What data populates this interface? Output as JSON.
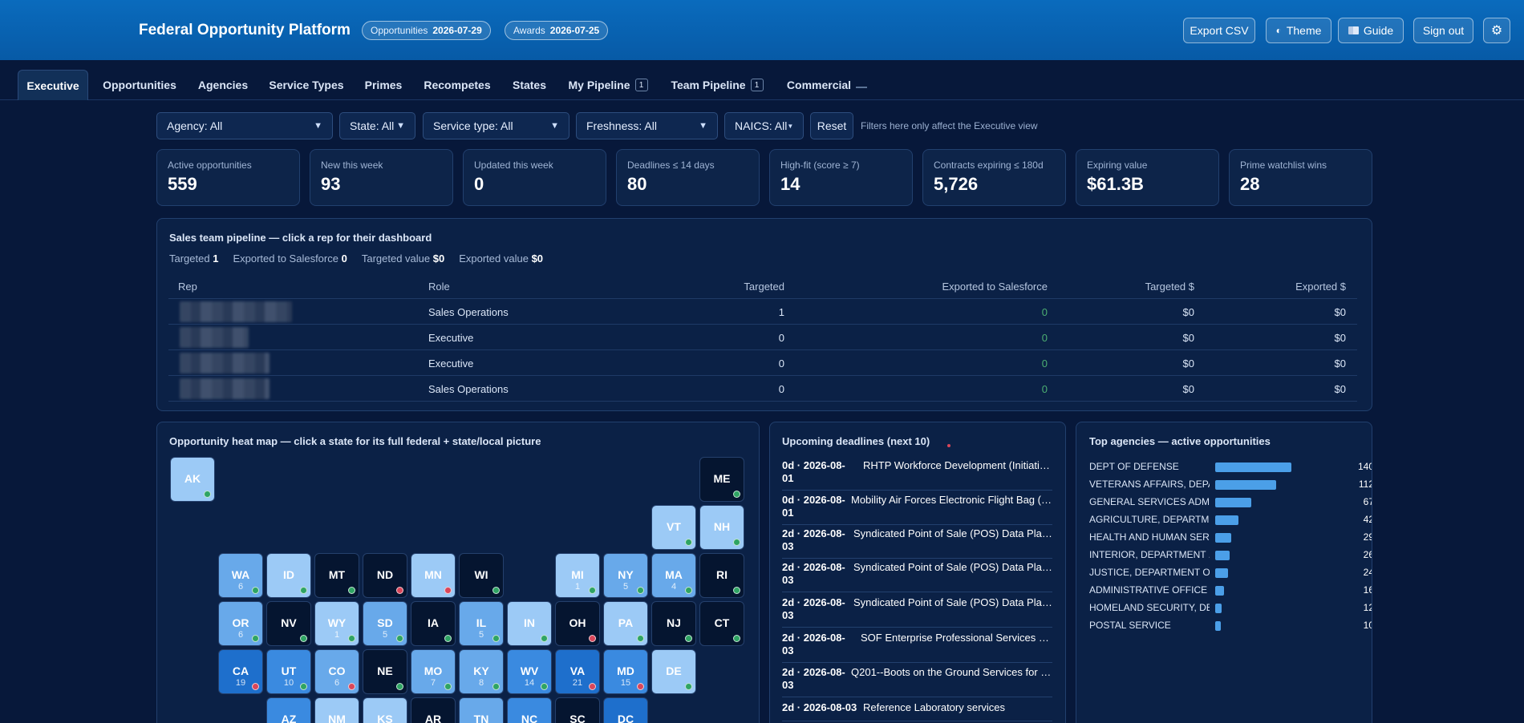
{
  "header": {
    "title": "Federal Opportunity Platform",
    "pills": [
      {
        "label": "Opportunities",
        "value": "2026-07-29"
      },
      {
        "label": "Awards",
        "value": "2026-07-25"
      }
    ],
    "buttons": {
      "export": "Export CSV",
      "theme": "Theme",
      "guide": "Guide",
      "signout": "Sign out"
    }
  },
  "tabs": [
    {
      "label": "Executive"
    },
    {
      "label": "Opportunities"
    },
    {
      "label": "Agencies"
    },
    {
      "label": "Service Types"
    },
    {
      "label": "Primes"
    },
    {
      "label": "Recompetes"
    },
    {
      "label": "States"
    },
    {
      "label": "My Pipeline",
      "count": "1"
    },
    {
      "label": "Team Pipeline",
      "count": "1"
    },
    {
      "label": "Commercial"
    }
  ],
  "filters": {
    "agency": "Agency: All",
    "state": "State: All",
    "service": "Service type: All",
    "freshness": "Freshness: All",
    "naics": "NAICS: All",
    "reset": "Reset",
    "note": "Filters here only affect the Executive view"
  },
  "kpis": [
    {
      "label": "Active opportunities",
      "value": "559"
    },
    {
      "label": "New this week",
      "value": "93"
    },
    {
      "label": "Updated this week",
      "value": "0"
    },
    {
      "label": "Deadlines ≤ 14 days",
      "value": "80"
    },
    {
      "label": "High-fit (score ≥ 7)",
      "value": "14"
    },
    {
      "label": "Contracts expiring ≤ 180d",
      "value": "5,726"
    },
    {
      "label": "Expiring value",
      "value": "$61.3B"
    },
    {
      "label": "Prime watchlist wins",
      "value": "28"
    }
  ],
  "pipeline": {
    "title": "Sales team pipeline — click a rep for their dashboard",
    "stats": [
      {
        "label": "Targeted",
        "value": "1"
      },
      {
        "label": "Exported to Salesforce",
        "value": "0"
      },
      {
        "label": "Targeted value",
        "value": "$0"
      },
      {
        "label": "Exported value",
        "value": "$0"
      }
    ],
    "columns": [
      "Rep",
      "Role",
      "Targeted",
      "Exported to Salesforce",
      "Targeted $",
      "Exported $"
    ],
    "rows": [
      {
        "role": "Sales Operations",
        "targeted": "1",
        "exported": "0",
        "tdol": "$0",
        "edol": "$0"
      },
      {
        "role": "Executive",
        "targeted": "0",
        "exported": "0",
        "tdol": "$0",
        "edol": "$0"
      },
      {
        "role": "Executive",
        "targeted": "0",
        "exported": "0",
        "tdol": "$0",
        "edol": "$0"
      },
      {
        "role": "Sales Operations",
        "targeted": "0",
        "exported": "0",
        "tdol": "$0",
        "edol": "$0"
      }
    ]
  },
  "heatmap": {
    "title": "Opportunity heat map — click a state for its full federal + state/local picture",
    "states": [
      {
        "abbr": "AK",
        "n": "",
        "level": 1,
        "dot": "g",
        "col": 0,
        "row": 0
      },
      {
        "abbr": "ME",
        "n": "",
        "level": 0,
        "dot": "g",
        "col": 11,
        "row": 0
      },
      {
        "abbr": "VT",
        "n": "",
        "level": 1,
        "dot": "g",
        "col": 10,
        "row": 1
      },
      {
        "abbr": "NH",
        "n": "",
        "level": 1,
        "dot": "g",
        "col": 11,
        "row": 1
      },
      {
        "abbr": "WA",
        "n": "6",
        "level": 2,
        "dot": "g",
        "col": 1,
        "row": 2
      },
      {
        "abbr": "ID",
        "n": "",
        "level": 1,
        "dot": "g",
        "col": 2,
        "row": 2
      },
      {
        "abbr": "MT",
        "n": "",
        "level": 0,
        "dot": "g",
        "col": 3,
        "row": 2
      },
      {
        "abbr": "ND",
        "n": "",
        "level": 0,
        "dot": "r",
        "col": 4,
        "row": 2
      },
      {
        "abbr": "MN",
        "n": "",
        "level": 1,
        "dot": "r",
        "col": 5,
        "row": 2
      },
      {
        "abbr": "WI",
        "n": "",
        "level": 0,
        "dot": "g",
        "col": 6,
        "row": 2
      },
      {
        "abbr": "MI",
        "n": "1",
        "level": 1,
        "dot": "g",
        "col": 8,
        "row": 2
      },
      {
        "abbr": "NY",
        "n": "5",
        "level": 2,
        "dot": "g",
        "col": 9,
        "row": 2
      },
      {
        "abbr": "MA",
        "n": "4",
        "level": 2,
        "dot": "g",
        "col": 10,
        "row": 2
      },
      {
        "abbr": "RI",
        "n": "",
        "level": 0,
        "dot": "g",
        "col": 11,
        "row": 2
      },
      {
        "abbr": "OR",
        "n": "6",
        "level": 2,
        "dot": "g",
        "col": 1,
        "row": 3
      },
      {
        "abbr": "NV",
        "n": "",
        "level": 0,
        "dot": "g",
        "col": 2,
        "row": 3
      },
      {
        "abbr": "WY",
        "n": "1",
        "level": 1,
        "dot": "g",
        "col": 3,
        "row": 3
      },
      {
        "abbr": "SD",
        "n": "5",
        "level": 2,
        "dot": "g",
        "col": 4,
        "row": 3
      },
      {
        "abbr": "IA",
        "n": "",
        "level": 0,
        "dot": "g",
        "col": 5,
        "row": 3
      },
      {
        "abbr": "IL",
        "n": "5",
        "level": 2,
        "dot": "g",
        "col": 6,
        "row": 3
      },
      {
        "abbr": "IN",
        "n": "",
        "level": 1,
        "dot": "g",
        "col": 7,
        "row": 3
      },
      {
        "abbr": "OH",
        "n": "",
        "level": 0,
        "dot": "r",
        "col": 8,
        "row": 3
      },
      {
        "abbr": "PA",
        "n": "",
        "level": 1,
        "dot": "g",
        "col": 9,
        "row": 3
      },
      {
        "abbr": "NJ",
        "n": "",
        "level": 0,
        "dot": "g",
        "col": 10,
        "row": 3
      },
      {
        "abbr": "CT",
        "n": "",
        "level": 0,
        "dot": "g",
        "col": 11,
        "row": 3
      },
      {
        "abbr": "CA",
        "n": "19",
        "level": 4,
        "dot": "r",
        "col": 1,
        "row": 4
      },
      {
        "abbr": "UT",
        "n": "10",
        "level": 3,
        "dot": "g",
        "col": 2,
        "row": 4
      },
      {
        "abbr": "CO",
        "n": "6",
        "level": 2,
        "dot": "r",
        "col": 3,
        "row": 4
      },
      {
        "abbr": "NE",
        "n": "",
        "level": 0,
        "dot": "g",
        "col": 4,
        "row": 4
      },
      {
        "abbr": "MO",
        "n": "7",
        "level": 2,
        "dot": "g",
        "col": 5,
        "row": 4
      },
      {
        "abbr": "KY",
        "n": "8",
        "level": 2,
        "dot": "g",
        "col": 6,
        "row": 4
      },
      {
        "abbr": "WV",
        "n": "14",
        "level": 3,
        "dot": "g",
        "col": 7,
        "row": 4
      },
      {
        "abbr": "VA",
        "n": "21",
        "level": 4,
        "dot": "r",
        "col": 8,
        "row": 4
      },
      {
        "abbr": "MD",
        "n": "15",
        "level": 3,
        "dot": "r",
        "col": 9,
        "row": 4
      },
      {
        "abbr": "DE",
        "n": "",
        "level": 1,
        "dot": "g",
        "col": 10,
        "row": 4
      },
      {
        "abbr": "AZ",
        "n": "",
        "level": 3,
        "dot": "",
        "col": 2,
        "row": 5
      },
      {
        "abbr": "NM",
        "n": "",
        "level": 1,
        "dot": "",
        "col": 3,
        "row": 5
      },
      {
        "abbr": "KS",
        "n": "",
        "level": 1,
        "dot": "",
        "col": 4,
        "row": 5
      },
      {
        "abbr": "AR",
        "n": "",
        "level": 0,
        "dot": "",
        "col": 5,
        "row": 5
      },
      {
        "abbr": "TN",
        "n": "",
        "level": 2,
        "dot": "",
        "col": 6,
        "row": 5
      },
      {
        "abbr": "NC",
        "n": "",
        "level": 3,
        "dot": "",
        "col": 7,
        "row": 5
      },
      {
        "abbr": "SC",
        "n": "",
        "level": 0,
        "dot": "",
        "col": 8,
        "row": 5
      },
      {
        "abbr": "DC",
        "n": "",
        "level": 4,
        "dot": "",
        "col": 9,
        "row": 5
      }
    ]
  },
  "deadlines": {
    "title": "Upcoming deadlines (next 10)",
    "items": [
      {
        "date": "0d · 2026-08-01",
        "title": "RHTP Workforce Development (Initiative ..."
      },
      {
        "date": "0d · 2026-08-01",
        "title": "Mobility Air Forces Electronic Flight Bag (M..."
      },
      {
        "date": "2d · 2026-08-03",
        "title": "Syndicated Point of Sale (POS) Data Platfor..."
      },
      {
        "date": "2d · 2026-08-03",
        "title": "Syndicated Point of Sale (POS) Data Platfor..."
      },
      {
        "date": "2d · 2026-08-03",
        "title": "Syndicated Point of Sale (POS) Data Platfor..."
      },
      {
        "date": "2d · 2026-08-03",
        "title": "SOF Enterprise Professional Services (SEP..."
      },
      {
        "date": "2d · 2026-08-03",
        "title": "Q201--Boots on the Ground Services for Co..."
      },
      {
        "date": "2d · 2026-08-03",
        "title": "Reference Laboratory services"
      }
    ]
  },
  "agencies": {
    "title": "Top agencies — active opportunities",
    "max": 140,
    "items": [
      {
        "name": "DEPT OF DEFENSE",
        "value": 140
      },
      {
        "name": "VETERANS AFFAIRS, DEPA...",
        "value": 112
      },
      {
        "name": "GENERAL SERVICES ADMI...",
        "value": 67
      },
      {
        "name": "AGRICULTURE, DEPARTME...",
        "value": 42
      },
      {
        "name": "HEALTH AND HUMAN SER...",
        "value": 29
      },
      {
        "name": "INTERIOR, DEPARTMENT ...",
        "value": 26
      },
      {
        "name": "JUSTICE, DEPARTMENT OF",
        "value": 24
      },
      {
        "name": "ADMINISTRATIVE OFFICE ...",
        "value": 16
      },
      {
        "name": "HOMELAND SECURITY, DE...",
        "value": 12
      },
      {
        "name": "POSTAL SERVICE",
        "value": 10
      }
    ]
  }
}
